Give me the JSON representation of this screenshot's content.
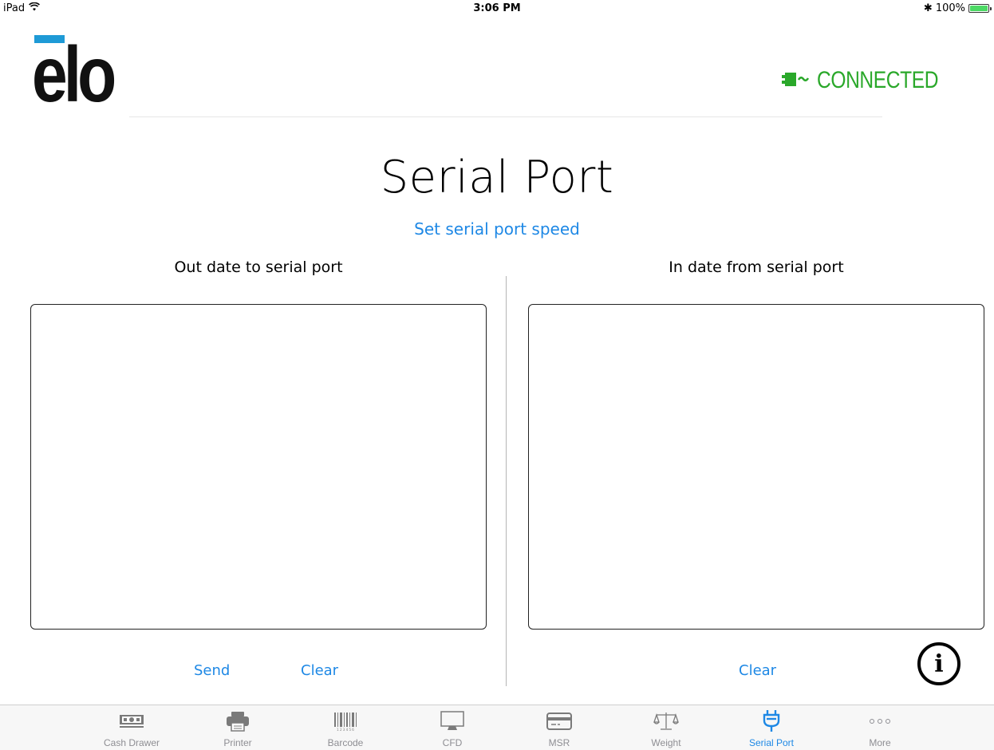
{
  "status_bar": {
    "device": "iPad",
    "time": "3:06 PM",
    "bluetooth": "✱",
    "battery": "100%",
    "battery_level": 1.0
  },
  "brand": {
    "logo_text": "elo",
    "logo_bar_color": "#1e9ad6"
  },
  "connection": {
    "label": "CONNECTED",
    "icon": "plug-icon",
    "color": "#2aa82a"
  },
  "page": {
    "title": "Serial Port",
    "speed_link": "Set serial port speed",
    "out_label": "Out date to serial port",
    "in_label": "In date from serial port",
    "out_value": "",
    "in_value": ""
  },
  "buttons": {
    "send": "Send",
    "clear_out": "Clear",
    "clear_in": "Clear",
    "info": "i"
  },
  "accent_color": "#1e88e5",
  "tabs": [
    {
      "label": "Cash Drawer",
      "icon": "cash-drawer-icon",
      "active": false
    },
    {
      "label": "Printer",
      "icon": "printer-icon",
      "active": false
    },
    {
      "label": "Barcode",
      "icon": "barcode-icon",
      "active": false
    },
    {
      "label": "CFD",
      "icon": "monitor-icon",
      "active": false
    },
    {
      "label": "MSR",
      "icon": "card-icon",
      "active": false
    },
    {
      "label": "Weight",
      "icon": "scale-icon",
      "active": false
    },
    {
      "label": "Serial Port",
      "icon": "plug-icon",
      "active": true
    },
    {
      "label": "More",
      "icon": "more-icon",
      "active": false
    }
  ]
}
